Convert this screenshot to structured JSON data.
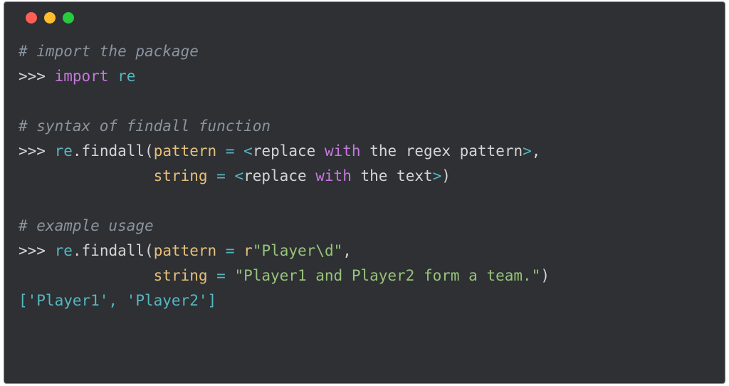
{
  "comments": {
    "c1": "# import the package",
    "c2": "# syntax of findall function",
    "c3": "# example usage"
  },
  "tokens": {
    "prompt": ">>> ",
    "import_kw": "import",
    "re_mod": "re",
    "dot": ".",
    "findall": "findall",
    "paren_open": "(",
    "paren_close": ")",
    "pattern_param": "pattern",
    "string_param": "string",
    "eq": " = ",
    "lt": "<",
    "gt": ">",
    "replace_word": "replace ",
    "with_kw": "with",
    "regex_pattern_text": " the regex pattern",
    "text_text": " the text",
    "comma": ",",
    "rstr_prefix": "r",
    "pattern_str": "\"Player\\d\"",
    "input_str": "\"Player1 and Player2 form a team.\"",
    "space_indent1": "               ",
    "space_indent2": "               "
  },
  "result": "['Player1', 'Player2']"
}
